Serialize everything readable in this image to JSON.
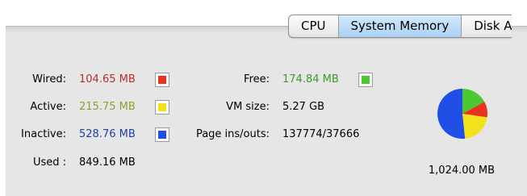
{
  "tabs": [
    {
      "label": "CPU",
      "selected": false
    },
    {
      "label": "System Memory",
      "selected": true
    },
    {
      "label": "Disk A",
      "selected": false
    }
  ],
  "left_rows": [
    {
      "label": "Wired:",
      "value": "104.65 MB",
      "value_color": "#b1302f",
      "swatch_color": "#e8341f"
    },
    {
      "label": "Active:",
      "value": "215.75 MB",
      "value_color": "#9a9a2e",
      "swatch_color": "#f3e21a"
    },
    {
      "label": "Inactive:",
      "value": "528.76 MB",
      "value_color": "#1f3fa5",
      "swatch_color": "#1f4fe6"
    },
    {
      "label": "Used :",
      "value": "849.16 MB",
      "value_color": "#000000"
    }
  ],
  "right_rows": [
    {
      "label": "Free:",
      "value": "174.84 MB",
      "value_color": "#3c9a2c",
      "swatch_color": "#4cc832"
    },
    {
      "label": "VM size:",
      "value": "5.27 GB",
      "value_color": "#000000"
    },
    {
      "label": "Page ins/outs:",
      "value": "137774/37666",
      "value_color": "#000000"
    }
  ],
  "pie": {
    "total_label": "1,024.00 MB",
    "slices": [
      {
        "name": "Free",
        "mb": 174.84,
        "color": "#4cc832"
      },
      {
        "name": "Wired",
        "mb": 104.65,
        "color": "#e8341f"
      },
      {
        "name": "Active",
        "mb": 215.75,
        "color": "#f3e21a"
      },
      {
        "name": "Inactive",
        "mb": 528.76,
        "color": "#1f4fe6"
      }
    ]
  }
}
